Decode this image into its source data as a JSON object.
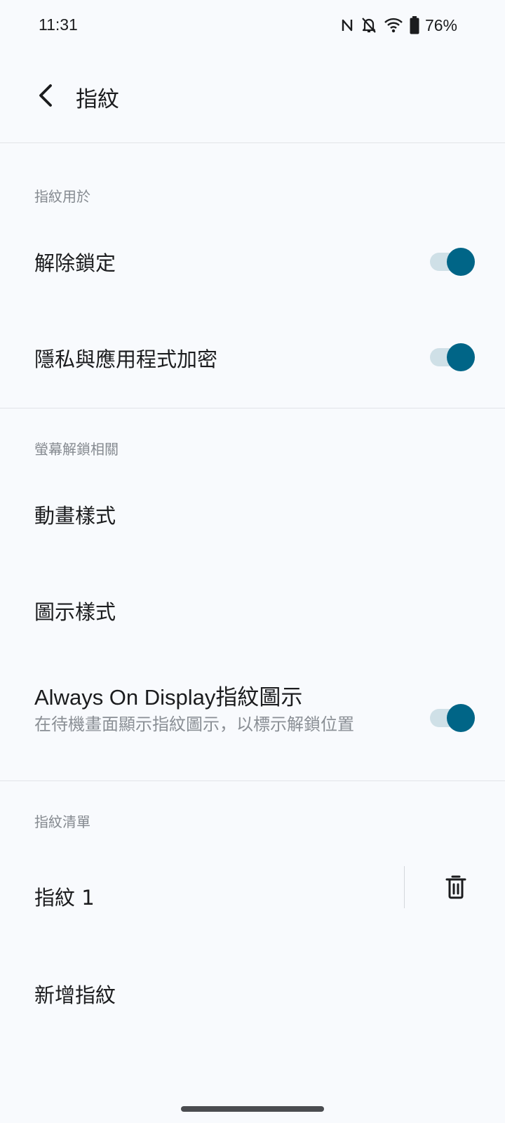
{
  "status_bar": {
    "time": "11:31",
    "battery_percent": "76%",
    "icons": [
      "nfc-icon",
      "bell-off-icon",
      "wifi-icon",
      "battery-icon"
    ]
  },
  "app_bar": {
    "title": "指紋",
    "back_icon": "chevron-left-icon"
  },
  "sections": {
    "usage": {
      "header": "指紋用於",
      "unlock": {
        "title": "解除鎖定",
        "switch_on": true
      },
      "privacy": {
        "title": "隱私與應用程式加密",
        "switch_on": true
      }
    },
    "screen_unlock": {
      "header": "螢幕解鎖相關",
      "animation": {
        "title": "動畫樣式"
      },
      "icon_style": {
        "title": "圖示樣式"
      },
      "aod": {
        "title": "Always On Display指紋圖示",
        "subtitle": "在待機畫面顯示指紋圖示，以標示解鎖位置",
        "switch_on": true
      }
    },
    "fingerprint_list": {
      "header": "指紋清單",
      "items": [
        {
          "title": "指紋 1",
          "action_icon": "trash-icon"
        }
      ],
      "add": {
        "title": "新增指紋"
      }
    }
  },
  "colors": {
    "background": "#f8fafd",
    "accent": "#006587",
    "switch_track": "#cfe0e7",
    "secondary_text": "#858a90"
  }
}
